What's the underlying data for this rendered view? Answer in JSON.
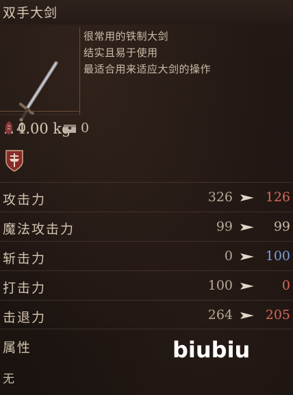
{
  "item": {
    "name": "双手大剑",
    "weight": "4.00 kg",
    "description": [
      "很常用的铁制大剑",
      "结实且易于使用",
      "最适合用来适应大剑的操作"
    ],
    "requirement_1": "0",
    "requirement_2": "0"
  },
  "stats": [
    {
      "label": "攻击力",
      "current": "326",
      "new": "126",
      "new_color": "#d9685a"
    },
    {
      "label": "魔法攻击力",
      "current": "99",
      "new": "99",
      "new_color": "#c9bba7"
    },
    {
      "label": "斩击力",
      "current": "0",
      "new": "100",
      "new_color": "#7f9fe0"
    },
    {
      "label": "打击力",
      "current": "100",
      "new": "0",
      "new_color": "#d9685a"
    },
    {
      "label": "击退力",
      "current": "264",
      "new": "205",
      "new_color": "#d9685a"
    }
  ],
  "attribute": {
    "label": "属性",
    "value": "无"
  },
  "watermark": "biubiu",
  "icons": {
    "weight": "weight-icon",
    "strength_req": "strength-requirement-icon",
    "chest": "chest-icon",
    "emblem": "class-emblem-icon",
    "arrow": "arrow-right-icon"
  }
}
